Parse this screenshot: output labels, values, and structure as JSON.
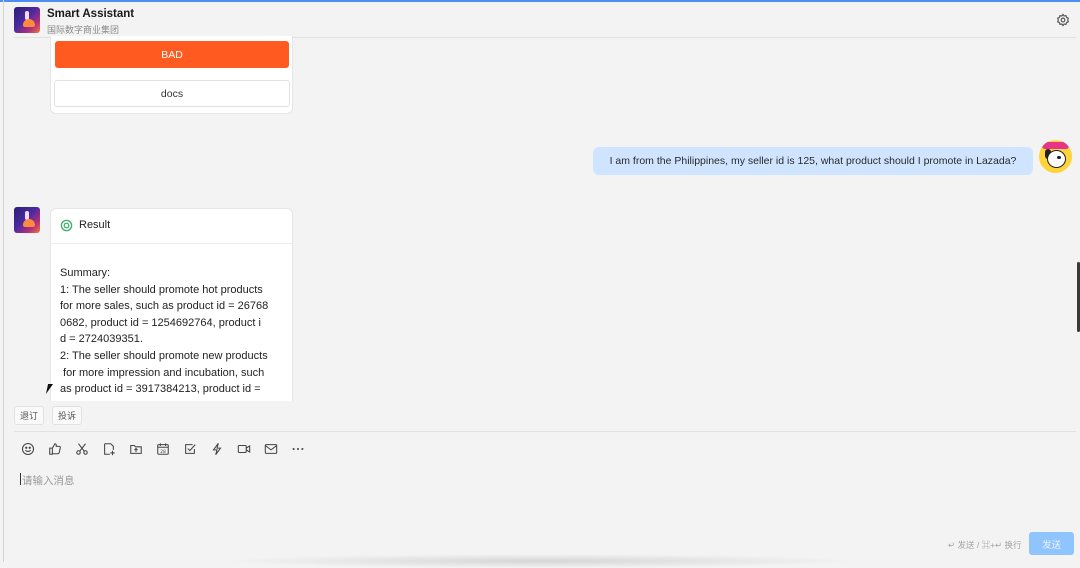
{
  "header": {
    "title": "Smart Assistant",
    "subtitle": "国际数字商业集团",
    "settings_icon": "gear-icon"
  },
  "options": {
    "bad_label": "BAD",
    "docs_label": "docs",
    "bad_color": "#ff5a1f"
  },
  "user_message": {
    "text": "I am from the Philippines, my seller id is 125, what product should I promote in Lazada?",
    "bubble_color": "#cfe5ff"
  },
  "result": {
    "title": "Result",
    "lines": [
      "Summary:",
      "1: The seller should promote hot products",
      "for more sales, such as product id = 26768",
      "0682, product id = 1254692764, product i",
      "d = 2724039351.",
      "2: The seller should promote new products",
      " for more impression and incubation, such",
      "as product id = 3917384213, product id ="
    ]
  },
  "actions": {
    "revise": "退订",
    "complain": "投诉"
  },
  "compose": {
    "placeholder": "请输入消息",
    "hint": "↵ 发送 / ⌘+↵ 换行",
    "send_label": "发送",
    "send_color": "#8fc4ff",
    "toolbar_icons": [
      "emoji-icon",
      "thumbs-up-icon",
      "scissors-icon",
      "file-add-icon",
      "folder-upload-icon",
      "calendar-icon",
      "checkbox-icon",
      "lightning-icon",
      "video-icon",
      "mail-icon",
      "more-icon"
    ]
  }
}
